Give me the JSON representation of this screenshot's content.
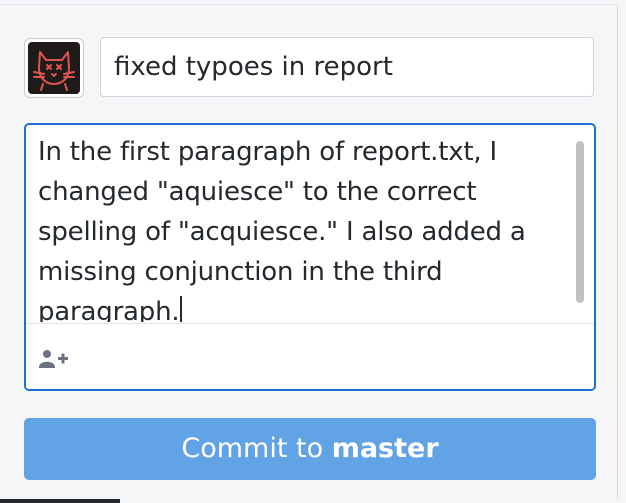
{
  "commit": {
    "avatar_icon": "cat-avatar-icon",
    "summary_value": "fixed typoes in report",
    "description_value": "In the first paragraph of report.txt, I changed \"aquiesce\" to the correct spelling of \"acquiesce.\" I also added a missing conjunction in the third paragraph.",
    "coauthor_icon": "add-user-icon",
    "button_prefix": "Commit to",
    "button_branch": "master"
  },
  "colors": {
    "focus_border": "#1f6fd1",
    "commit_button": "#62a3e5",
    "avatar_bg": "#1f1b1b",
    "avatar_stroke": "#e0554d"
  }
}
